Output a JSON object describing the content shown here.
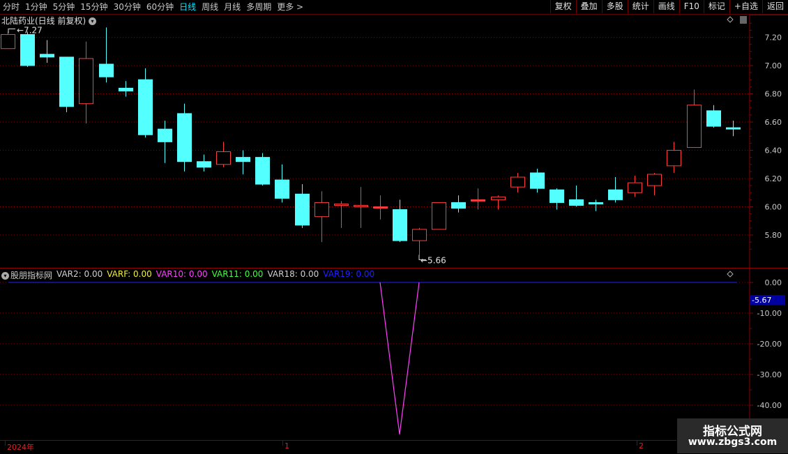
{
  "toolbar": {
    "periods": [
      {
        "label": "分时",
        "active": false
      },
      {
        "label": "1分钟",
        "active": false
      },
      {
        "label": "5分钟",
        "active": false
      },
      {
        "label": "15分钟",
        "active": false
      },
      {
        "label": "30分钟",
        "active": false
      },
      {
        "label": "60分钟",
        "active": false
      },
      {
        "label": "日线",
        "active": true
      },
      {
        "label": "周线",
        "active": false
      },
      {
        "label": "月线",
        "active": false
      },
      {
        "label": "多周期",
        "active": false
      },
      {
        "label": "更多 >",
        "active": false
      }
    ],
    "buttons": [
      "复权",
      "叠加",
      "多股",
      "统计",
      "画线",
      "F10",
      "标记",
      "+自选",
      "返回"
    ]
  },
  "main": {
    "title": "北陆药业(日线 前复权)",
    "high_label": "7.27",
    "low_label": "5.66",
    "y_ticks": [
      "7.20",
      "7.00",
      "6.80",
      "6.60",
      "6.40",
      "6.20",
      "6.00",
      "5.80"
    ]
  },
  "indicator": {
    "name": "股朋指标网",
    "vars": [
      {
        "text": "VAR2: 0.00",
        "color": "#d0d0d0"
      },
      {
        "text": "VARF: 0.00",
        "color": "#f0f040"
      },
      {
        "text": "VAR10: 0.00",
        "color": "#ff40ff"
      },
      {
        "text": "VAR11: 0.00",
        "color": "#40ff40"
      },
      {
        "text": "VAR18: 0.00",
        "color": "#d0d0d0"
      },
      {
        "text": "VAR19: 0.00",
        "color": "#2020ff"
      }
    ],
    "y_ticks": [
      "0.00",
      "-10.00",
      "-20.00",
      "-30.00",
      "-40.00"
    ],
    "current_value": "-5.67"
  },
  "date_axis": {
    "labels": [
      "2024年",
      "1",
      "2"
    ]
  },
  "watermark": {
    "line1": "指标公式网",
    "line2": "www.zbgs3.com"
  },
  "colors": {
    "up": "#ff3c3c",
    "down": "#54ffff",
    "grid": "#8a0000",
    "axis": "#c8c8c8",
    "var10": "#ff40ff",
    "var19": "#2020ff"
  },
  "chart_data": {
    "type": "candlestick",
    "y_range": [
      5.66,
      7.27
    ],
    "candles": [
      {
        "o": 7.12,
        "c": 7.22,
        "h": 7.24,
        "l": 7.12
      },
      {
        "o": 7.22,
        "c": 7.0,
        "h": 7.24,
        "l": 6.99
      },
      {
        "o": 7.08,
        "c": 7.06,
        "h": 7.18,
        "l": 7.02
      },
      {
        "o": 7.06,
        "c": 6.71,
        "h": 7.06,
        "l": 6.67
      },
      {
        "o": 6.73,
        "c": 7.05,
        "h": 7.17,
        "l": 6.59
      },
      {
        "o": 7.01,
        "c": 6.92,
        "h": 7.27,
        "l": 6.88
      },
      {
        "o": 6.84,
        "c": 6.82,
        "h": 6.89,
        "l": 6.78
      },
      {
        "o": 6.9,
        "c": 6.51,
        "h": 6.98,
        "l": 6.49
      },
      {
        "o": 6.55,
        "c": 6.46,
        "h": 6.61,
        "l": 6.31
      },
      {
        "o": 6.66,
        "c": 6.32,
        "h": 6.73,
        "l": 6.25
      },
      {
        "o": 6.32,
        "c": 6.28,
        "h": 6.37,
        "l": 6.25
      },
      {
        "o": 6.3,
        "c": 6.39,
        "h": 6.46,
        "l": 6.28
      },
      {
        "o": 6.35,
        "c": 6.32,
        "h": 6.4,
        "l": 6.23
      },
      {
        "o": 6.35,
        "c": 6.16,
        "h": 6.38,
        "l": 6.15
      },
      {
        "o": 6.19,
        "c": 6.06,
        "h": 6.3,
        "l": 6.03
      },
      {
        "o": 6.09,
        "c": 5.87,
        "h": 6.16,
        "l": 5.85
      },
      {
        "o": 5.93,
        "c": 6.03,
        "h": 6.11,
        "l": 5.75
      },
      {
        "o": 6.01,
        "c": 6.02,
        "h": 6.04,
        "l": 5.85
      },
      {
        "o": 6.0,
        "c": 6.01,
        "h": 6.14,
        "l": 5.85
      },
      {
        "o": 6.0,
        "c": 6.0,
        "h": 6.08,
        "l": 5.91
      },
      {
        "o": 5.98,
        "c": 5.76,
        "h": 6.05,
        "l": 5.75
      },
      {
        "o": 5.76,
        "c": 5.84,
        "h": 5.85,
        "l": 5.66
      },
      {
        "o": 5.84,
        "c": 6.03,
        "h": 6.03,
        "l": 5.84
      },
      {
        "o": 6.03,
        "c": 5.99,
        "h": 6.08,
        "l": 5.96
      },
      {
        "o": 6.05,
        "c": 6.05,
        "h": 6.13,
        "l": 5.98
      },
      {
        "o": 6.05,
        "c": 6.07,
        "h": 6.08,
        "l": 5.98
      },
      {
        "o": 6.14,
        "c": 6.21,
        "h": 6.24,
        "l": 6.1
      },
      {
        "o": 6.24,
        "c": 6.13,
        "h": 6.27,
        "l": 6.1
      },
      {
        "o": 6.12,
        "c": 6.03,
        "h": 6.13,
        "l": 5.98
      },
      {
        "o": 6.05,
        "c": 6.01,
        "h": 6.15,
        "l": 6.0
      },
      {
        "o": 6.03,
        "c": 6.02,
        "h": 6.05,
        "l": 5.97
      },
      {
        "o": 6.12,
        "c": 6.05,
        "h": 6.21,
        "l": 6.03
      },
      {
        "o": 6.1,
        "c": 6.17,
        "h": 6.22,
        "l": 6.07
      },
      {
        "o": 6.15,
        "c": 6.23,
        "h": 6.24,
        "l": 6.08
      },
      {
        "o": 6.29,
        "c": 6.4,
        "h": 6.46,
        "l": 6.24
      },
      {
        "o": 6.42,
        "c": 6.72,
        "h": 6.83,
        "l": 6.42
      },
      {
        "o": 6.68,
        "c": 6.57,
        "h": 6.72,
        "l": 6.56
      },
      {
        "o": 6.56,
        "c": 6.55,
        "h": 6.61,
        "l": 6.5
      }
    ],
    "indicator_series": {
      "name": "VAR10",
      "values_note": "0 everywhere except a single spike",
      "spike_index_range": [
        19,
        21
      ],
      "spike_min": -49.5
    },
    "ind_y_range": [
      -50,
      2
    ]
  }
}
